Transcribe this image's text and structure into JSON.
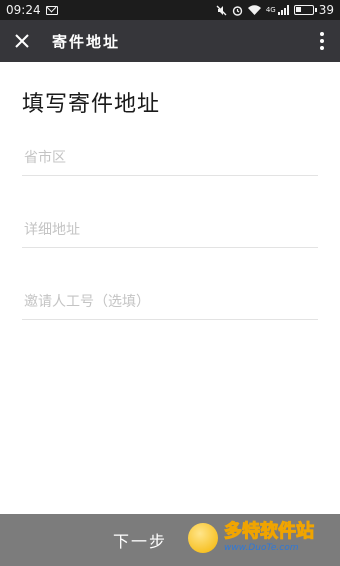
{
  "status_bar": {
    "time": "09:24",
    "battery_level": "39",
    "network_type": "4G",
    "icons": [
      "mail-icon",
      "mute-icon",
      "alarm-icon",
      "wifi-icon",
      "signal-icon",
      "battery-icon"
    ]
  },
  "title_bar": {
    "title": "寄件地址",
    "close_icon": "close-icon",
    "menu_icon": "more-vertical-icon"
  },
  "form": {
    "heading": "填写寄件地址",
    "region_placeholder": "省市区",
    "address_placeholder": "详细地址",
    "inviter_placeholder": "邀请人工号（选填）"
  },
  "footer": {
    "next_label": "下一步"
  },
  "watermark": {
    "brand": "多特软件站",
    "url": "www.DuoTe.com"
  },
  "colors": {
    "status_bar_bg": "#1c1c1c",
    "title_bar_bg": "#36363a",
    "next_bar_bg": "#7c7c7c"
  }
}
